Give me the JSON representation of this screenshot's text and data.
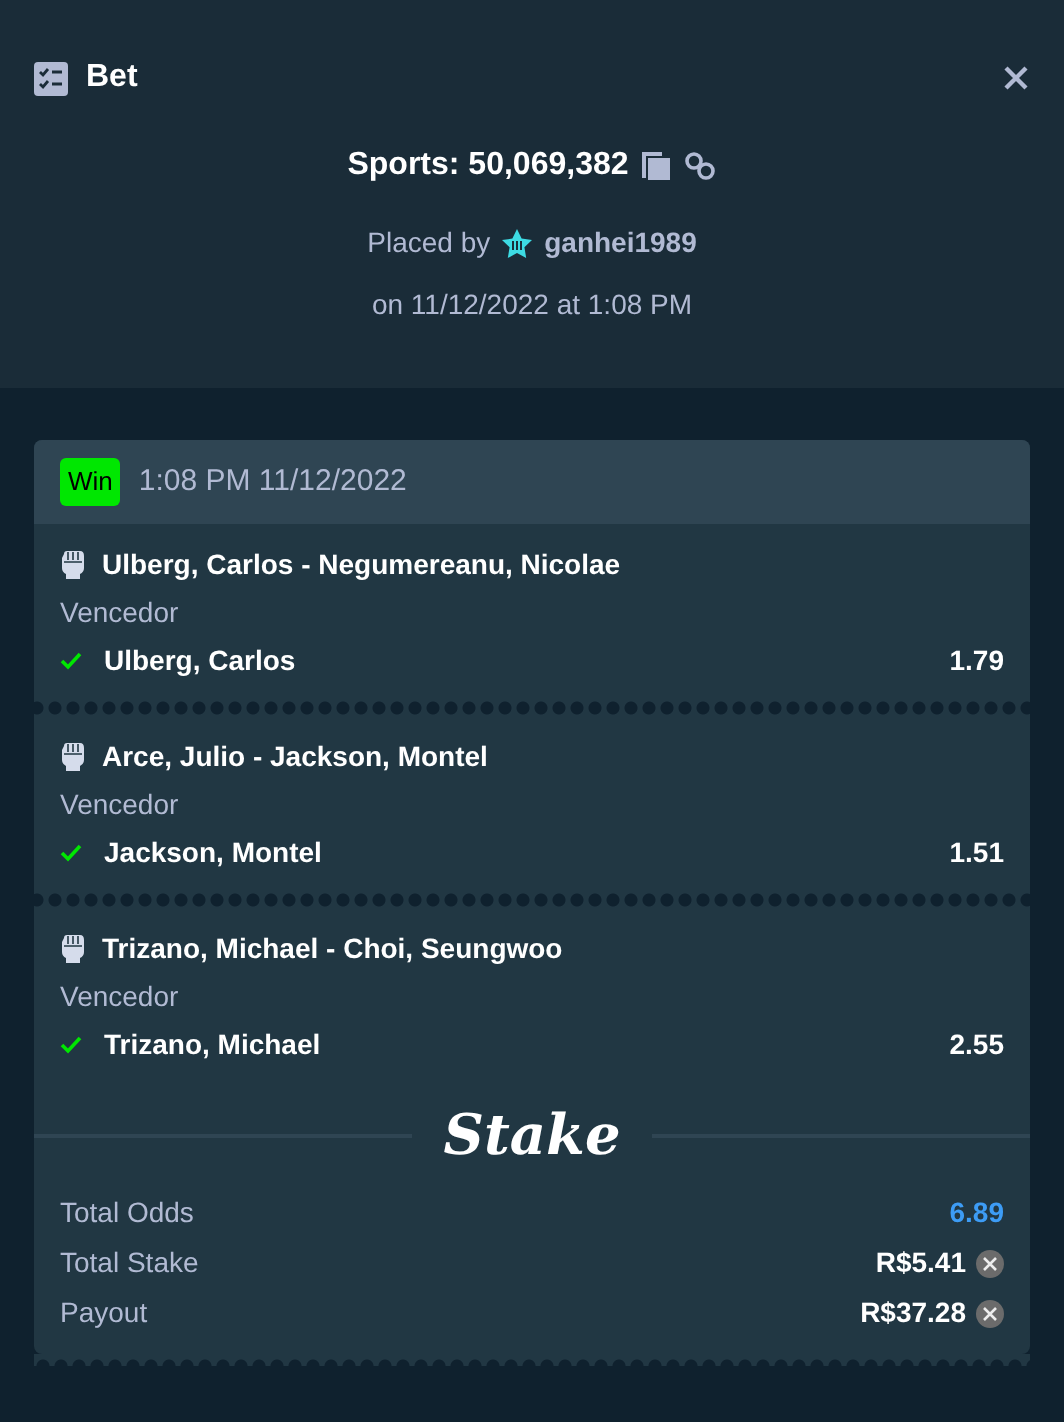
{
  "modal": {
    "title": "Bet"
  },
  "bet": {
    "id": "Sports: 50,069,382",
    "placed_by": "Placed by",
    "user": "ganhei1989",
    "placed_on": "on 11/12/2022 at 1:08 PM"
  },
  "slip": {
    "status": {
      "label": "Win",
      "kind": "win"
    },
    "time": "1:08 PM 11/12/2022",
    "legs": [
      {
        "event": "Ulberg, Carlos - Negumereanu, Nicolae",
        "market": "Vencedor",
        "pick": "Ulberg, Carlos",
        "odds": "1.79",
        "won": true
      },
      {
        "event": "Arce, Julio - Jackson, Montel",
        "market": "Vencedor",
        "pick": "Jackson, Montel",
        "odds": "1.51",
        "won": true
      },
      {
        "event": "Trizano, Michael - Choi, Seungwoo",
        "market": "Vencedor",
        "pick": "Trizano, Michael",
        "odds": "2.55",
        "won": true
      }
    ],
    "brand": "Stake",
    "totals": [
      {
        "label": "Total Odds",
        "value": "6.89",
        "kind": "odds"
      },
      {
        "label": "Total Stake",
        "value": "R$5.41",
        "kind": "currency"
      },
      {
        "label": "Payout",
        "value": "R$37.28",
        "kind": "currency"
      }
    ]
  }
}
